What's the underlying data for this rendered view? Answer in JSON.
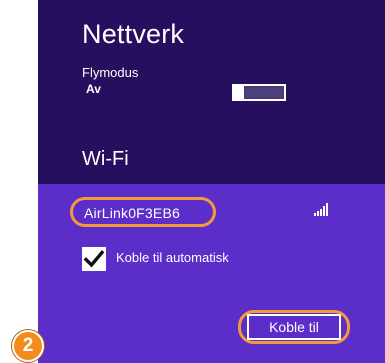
{
  "panel": {
    "title": "Nettverk",
    "airplane_mode": {
      "label": "Flymodus",
      "state": "Av",
      "on": false
    },
    "wifi_heading": "Wi-Fi"
  },
  "network": {
    "name": "AirLink0F3EB6",
    "signal_icon": "signal-bars-icon",
    "auto_connect": {
      "label": "Koble til automatisk",
      "checked": true
    },
    "connect_label": "Koble til"
  },
  "annotation": {
    "step": "2"
  },
  "colors": {
    "panel_bg": "#260f5e",
    "selected_bg": "#5b2dc9",
    "highlight": "#f39b3b",
    "badge": "#f28c1f"
  }
}
